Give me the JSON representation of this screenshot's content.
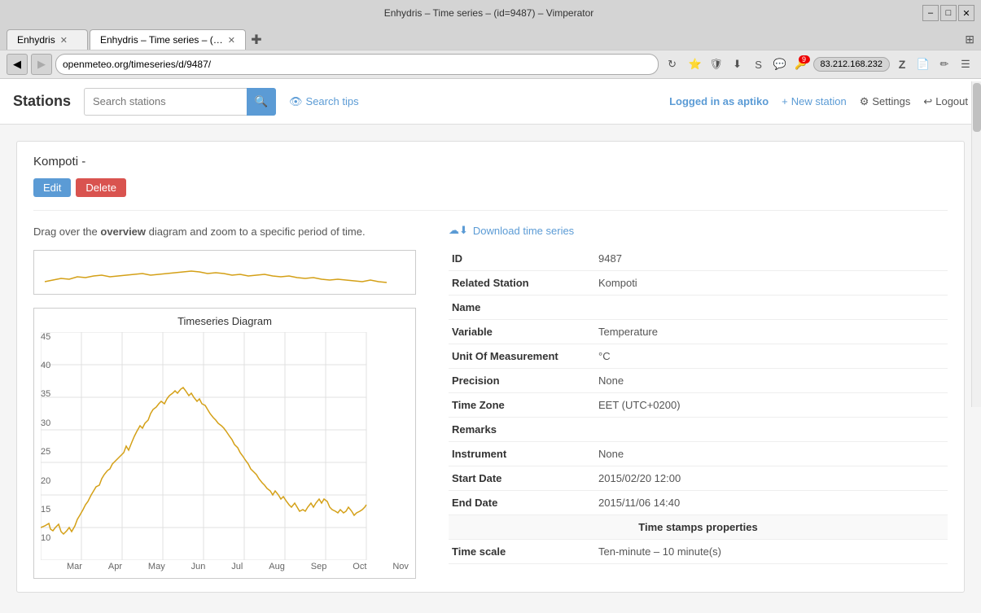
{
  "browser": {
    "title": "Enhydris – Time series – (id=9487) – Vimperator",
    "tabs": [
      {
        "label": "Enhydris",
        "active": false,
        "closable": true
      },
      {
        "label": "Enhydris – Time series – (…",
        "active": true,
        "closable": true
      }
    ],
    "url": "openmeteo.org/timeseries/d/9487/",
    "ip": "83.212.168.232",
    "window_controls": [
      "–",
      "□",
      "✕"
    ]
  },
  "header": {
    "app_title": "Stations",
    "search_placeholder": "Search stations",
    "search_btn_icon": "🔍",
    "search_tips_label": "Search tips",
    "logged_in_label": "Logged in as",
    "username": "aptiko",
    "new_station_label": "New station",
    "settings_label": "Settings",
    "logout_label": "Logout"
  },
  "page": {
    "station_title": "Kompoti -",
    "edit_label": "Edit",
    "delete_label": "Delete",
    "drag_hint_prefix": "Drag over the ",
    "drag_hint_bold": "overview",
    "drag_hint_suffix": " diagram and zoom to a specific period of time.",
    "chart_title": "Timeseries Diagram",
    "download_label": "Download time series",
    "y_labels": [
      "45",
      "40",
      "35",
      "30",
      "25",
      "20",
      "15",
      "10"
    ],
    "x_labels": [
      "Mar",
      "Apr",
      "May",
      "Jun",
      "Jul",
      "Aug",
      "Sep",
      "Oct",
      "Nov"
    ],
    "info_rows": [
      {
        "label": "ID",
        "value": "9487",
        "is_link": false
      },
      {
        "label": "Related Station",
        "value": "Kompoti",
        "is_link": true
      },
      {
        "label": "Name",
        "value": "",
        "is_link": false
      },
      {
        "label": "Variable",
        "value": "Temperature",
        "is_link": false
      },
      {
        "label": "Unit Of Measurement",
        "value": "°C",
        "is_link": false
      },
      {
        "label": "Precision",
        "value": "None",
        "is_link": false
      },
      {
        "label": "Time Zone",
        "value": "EET (UTC+0200)",
        "is_link": false
      },
      {
        "label": "Remarks",
        "value": "",
        "is_link": false
      },
      {
        "label": "Instrument",
        "value": "None",
        "is_link": false
      },
      {
        "label": "Start Date",
        "value": "2015/02/20 12:00",
        "is_link": false
      },
      {
        "label": "End Date",
        "value": "2015/11/06 14:40",
        "is_link": false
      }
    ],
    "section_header": "Time stamps properties",
    "time_scale_label": "Time scale",
    "time_scale_value": "Ten-minute – 10 minute(s)"
  },
  "icons": {
    "eye": "👁",
    "download": "⬇",
    "cloud_download": "☁",
    "plus": "+",
    "gear": "⚙",
    "sign_out": "↩",
    "search": "🔍"
  }
}
